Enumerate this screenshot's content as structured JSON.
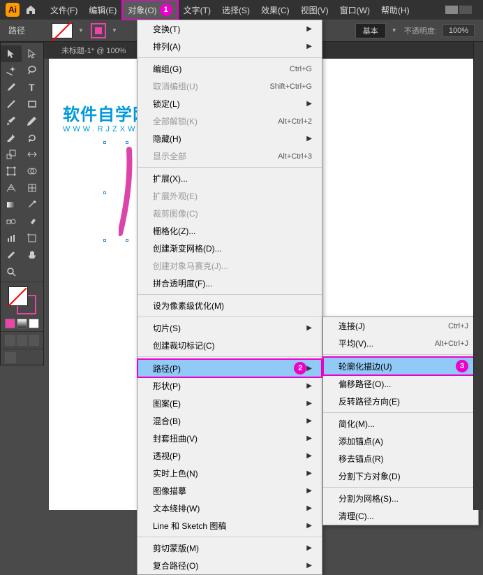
{
  "app": {
    "name": "Ai"
  },
  "menubar": {
    "items": [
      "文件(F)",
      "编辑(E)",
      "对象(O)",
      "文字(T)",
      "选择(S)",
      "效果(C)",
      "视图(V)",
      "窗口(W)",
      "帮助(H)"
    ],
    "active_index": 2
  },
  "controlbar": {
    "label": "路径",
    "basic": "基本",
    "opacity_label": "不透明度:",
    "opacity_value": "100%"
  },
  "tab": {
    "title": "未标题-1* @ 100%"
  },
  "watermark": {
    "title": "软件自学网",
    "url": "WWW.RJZXW.COM"
  },
  "menu1": {
    "items": [
      {
        "label": "变换(T)",
        "arrow": true
      },
      {
        "label": "排列(A)",
        "arrow": true
      },
      {
        "sep": true
      },
      {
        "label": "编组(G)",
        "shortcut": "Ctrl+G"
      },
      {
        "label": "取消编组(U)",
        "shortcut": "Shift+Ctrl+G",
        "disabled": true
      },
      {
        "label": "锁定(L)",
        "arrow": true
      },
      {
        "label": "全部解锁(K)",
        "shortcut": "Alt+Ctrl+2",
        "disabled": true
      },
      {
        "label": "隐藏(H)",
        "arrow": true
      },
      {
        "label": "显示全部",
        "shortcut": "Alt+Ctrl+3",
        "disabled": true
      },
      {
        "sep": true
      },
      {
        "label": "扩展(X)..."
      },
      {
        "label": "扩展外观(E)",
        "disabled": true
      },
      {
        "label": "裁剪图像(C)",
        "disabled": true
      },
      {
        "label": "栅格化(Z)..."
      },
      {
        "label": "创建渐变网格(D)..."
      },
      {
        "label": "创建对象马赛克(J)...",
        "disabled": true
      },
      {
        "label": "拼合透明度(F)..."
      },
      {
        "sep": true
      },
      {
        "label": "设为像素级优化(M)"
      },
      {
        "sep": true
      },
      {
        "label": "切片(S)",
        "arrow": true
      },
      {
        "label": "创建裁切标记(C)"
      },
      {
        "sep": true
      },
      {
        "label": "路径(P)",
        "arrow": true,
        "highlighted": true,
        "annotation": "2"
      },
      {
        "label": "形状(P)",
        "arrow": true
      },
      {
        "label": "图案(E)",
        "arrow": true
      },
      {
        "label": "混合(B)",
        "arrow": true
      },
      {
        "label": "封套扭曲(V)",
        "arrow": true
      },
      {
        "label": "透视(P)",
        "arrow": true
      },
      {
        "label": "实时上色(N)",
        "arrow": true
      },
      {
        "label": "图像描摹",
        "arrow": true
      },
      {
        "label": "文本绕排(W)",
        "arrow": true
      },
      {
        "label": "Line 和 Sketch 图稿",
        "arrow": true
      },
      {
        "sep": true
      },
      {
        "label": "剪切蒙版(M)",
        "arrow": true
      },
      {
        "label": "复合路径(O)",
        "arrow": true
      }
    ]
  },
  "menu2": {
    "items": [
      {
        "label": "连接(J)",
        "shortcut": "Ctrl+J"
      },
      {
        "label": "平均(V)...",
        "shortcut": "Alt+Ctrl+J"
      },
      {
        "sep": true
      },
      {
        "label": "轮廓化描边(U)",
        "highlighted": true,
        "annotation": "3"
      },
      {
        "label": "偏移路径(O)..."
      },
      {
        "label": "反转路径方向(E)"
      },
      {
        "sep": true
      },
      {
        "label": "简化(M)..."
      },
      {
        "label": "添加锚点(A)"
      },
      {
        "label": "移去锚点(R)"
      },
      {
        "label": "分割下方对象(D)"
      },
      {
        "sep": true
      },
      {
        "label": "分割为网格(S)..."
      },
      {
        "label": "清理(C)..."
      }
    ]
  },
  "annotations": {
    "a1": "1"
  }
}
